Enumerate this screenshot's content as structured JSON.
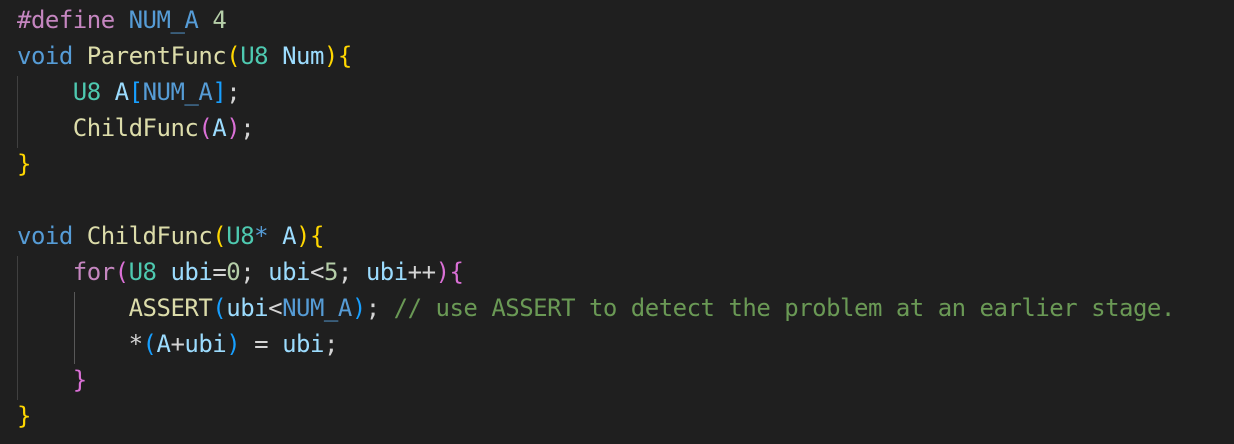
{
  "colors": {
    "background": "#1f1f1f",
    "preprocessor": "#c586c0",
    "macro": "#569cd6",
    "number": "#b5cea8",
    "keyword": "#569cd6",
    "control": "#c586c0",
    "type": "#4ec9b0",
    "function": "#dcdcaa",
    "variable": "#9cdcfe",
    "comment": "#6a9955",
    "bracket_level_1": "#ffd700",
    "bracket_level_2": "#da70d6",
    "bracket_level_3": "#179fff",
    "text": "#d4d4d4"
  },
  "code": {
    "lines": [
      [
        {
          "t": "#define",
          "c": "preproc"
        },
        {
          "t": " ",
          "c": "punct"
        },
        {
          "t": "NUM_A",
          "c": "macro"
        },
        {
          "t": " ",
          "c": "punct"
        },
        {
          "t": "4",
          "c": "number"
        }
      ],
      [
        {
          "t": "void",
          "c": "keyword"
        },
        {
          "t": " ",
          "c": "punct"
        },
        {
          "t": "ParentFunc",
          "c": "func"
        },
        {
          "t": "(",
          "c": "brace1"
        },
        {
          "t": "U8",
          "c": "type"
        },
        {
          "t": " ",
          "c": "punct"
        },
        {
          "t": "Num",
          "c": "param"
        },
        {
          "t": ")",
          "c": "brace1"
        },
        {
          "t": "{",
          "c": "brace1"
        }
      ],
      [
        {
          "t": "    ",
          "c": "punct"
        },
        {
          "t": "U8",
          "c": "type"
        },
        {
          "t": " ",
          "c": "punct"
        },
        {
          "t": "A",
          "c": "var"
        },
        {
          "t": "[",
          "c": "brace3"
        },
        {
          "t": "NUM_A",
          "c": "macro"
        },
        {
          "t": "]",
          "c": "brace3"
        },
        {
          "t": ";",
          "c": "punct"
        }
      ],
      [
        {
          "t": "    ",
          "c": "punct"
        },
        {
          "t": "ChildFunc",
          "c": "func"
        },
        {
          "t": "(",
          "c": "brace2"
        },
        {
          "t": "A",
          "c": "var"
        },
        {
          "t": ")",
          "c": "brace2"
        },
        {
          "t": ";",
          "c": "punct"
        }
      ],
      [
        {
          "t": "}",
          "c": "brace1"
        }
      ],
      [],
      [
        {
          "t": "void",
          "c": "keyword"
        },
        {
          "t": " ",
          "c": "punct"
        },
        {
          "t": "ChildFunc",
          "c": "func"
        },
        {
          "t": "(",
          "c": "brace1"
        },
        {
          "t": "U8",
          "c": "type"
        },
        {
          "t": "*",
          "c": "ptr"
        },
        {
          "t": " ",
          "c": "punct"
        },
        {
          "t": "A",
          "c": "param"
        },
        {
          "t": ")",
          "c": "brace1"
        },
        {
          "t": "{",
          "c": "brace1"
        }
      ],
      [
        {
          "t": "    ",
          "c": "punct"
        },
        {
          "t": "for",
          "c": "control"
        },
        {
          "t": "(",
          "c": "brace2"
        },
        {
          "t": "U8",
          "c": "type"
        },
        {
          "t": " ",
          "c": "punct"
        },
        {
          "t": "ubi",
          "c": "var"
        },
        {
          "t": "=",
          "c": "op"
        },
        {
          "t": "0",
          "c": "number"
        },
        {
          "t": "; ",
          "c": "punct"
        },
        {
          "t": "ubi",
          "c": "var"
        },
        {
          "t": "<",
          "c": "op"
        },
        {
          "t": "5",
          "c": "number"
        },
        {
          "t": "; ",
          "c": "punct"
        },
        {
          "t": "ubi",
          "c": "var"
        },
        {
          "t": "++",
          "c": "op"
        },
        {
          "t": ")",
          "c": "brace2"
        },
        {
          "t": "{",
          "c": "brace2"
        }
      ],
      [
        {
          "t": "        ",
          "c": "punct"
        },
        {
          "t": "ASSERT",
          "c": "func"
        },
        {
          "t": "(",
          "c": "brace3"
        },
        {
          "t": "ubi",
          "c": "var"
        },
        {
          "t": "<",
          "c": "op"
        },
        {
          "t": "NUM_A",
          "c": "macro"
        },
        {
          "t": ")",
          "c": "brace3"
        },
        {
          "t": ";",
          "c": "punct"
        },
        {
          "t": " ",
          "c": "punct"
        },
        {
          "t": "// use ASSERT to detect the problem at an earlier stage.",
          "c": "comment"
        }
      ],
      [
        {
          "t": "        ",
          "c": "punct"
        },
        {
          "t": "*",
          "c": "op"
        },
        {
          "t": "(",
          "c": "brace3"
        },
        {
          "t": "A",
          "c": "var"
        },
        {
          "t": "+",
          "c": "op"
        },
        {
          "t": "ubi",
          "c": "var"
        },
        {
          "t": ")",
          "c": "brace3"
        },
        {
          "t": " = ",
          "c": "op"
        },
        {
          "t": "ubi",
          "c": "var"
        },
        {
          "t": ";",
          "c": "punct"
        }
      ],
      [
        {
          "t": "    ",
          "c": "punct"
        },
        {
          "t": "}",
          "c": "brace2"
        }
      ],
      [
        {
          "t": "}",
          "c": "brace1"
        }
      ]
    ]
  }
}
